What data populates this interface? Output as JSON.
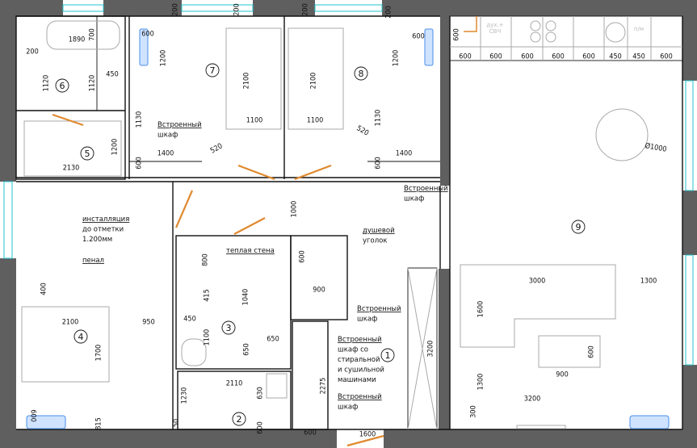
{
  "plan": {
    "room_numbers": [
      "1",
      "2",
      "3",
      "4",
      "5",
      "6",
      "7",
      "8",
      "9"
    ],
    "dimensions": [
      "200",
      "200",
      "200",
      "200",
      "1890",
      "700",
      "200",
      "1120",
      "1120",
      "450",
      "600",
      "1200",
      "2100",
      "2100",
      "1100",
      "1100",
      "1130",
      "1400",
      "520",
      "600",
      "1200",
      "2130",
      "600",
      "1200",
      "1130",
      "520",
      "1400",
      "600",
      "600",
      "600",
      "600",
      "600",
      "600",
      "600",
      "450",
      "450",
      "600",
      "Ø1000",
      "1000",
      "600",
      "800",
      "415",
      "1040",
      "900",
      "400",
      "2100",
      "950",
      "450",
      "1100",
      "650",
      "650",
      "1700",
      "3200",
      "2110",
      "630",
      "2275",
      "1230",
      "600",
      "815",
      "600",
      "50",
      "600",
      "1600",
      "3000",
      "1300",
      "1600",
      "600",
      "900",
      "1300",
      "3200",
      "300"
    ],
    "annotations": {
      "wardrobe_room7": [
        "Встроенный",
        "шкаф"
      ],
      "wardrobe_room8": [
        "Встроенный",
        "шкаф"
      ],
      "installation": [
        "инсталляция",
        "до отметки",
        "1.200мм"
      ],
      "pencil_case": [
        "пенал"
      ],
      "shower": [
        "душевой",
        "уголок"
      ],
      "warm_wall": [
        "теплая стена"
      ],
      "wardrobe_corridor": [
        "Встроенный",
        "шкаф"
      ],
      "wardrobe_laundry": [
        "Встроенный",
        "шкаф со",
        "стиральной",
        "и сушильной",
        "машинами"
      ],
      "wardrobe_bottom": [
        "Встроенный",
        "шкаф"
      ]
    },
    "kitchen_labels": {
      "oven": [
        "дух.+",
        "СВЧ"
      ],
      "dishwasher": [
        "п/м"
      ]
    },
    "colors": {
      "wall": "#5f5f5f",
      "window": "#22c6cf",
      "door": "#e0892f",
      "radiator": "#4a8ee8"
    }
  }
}
